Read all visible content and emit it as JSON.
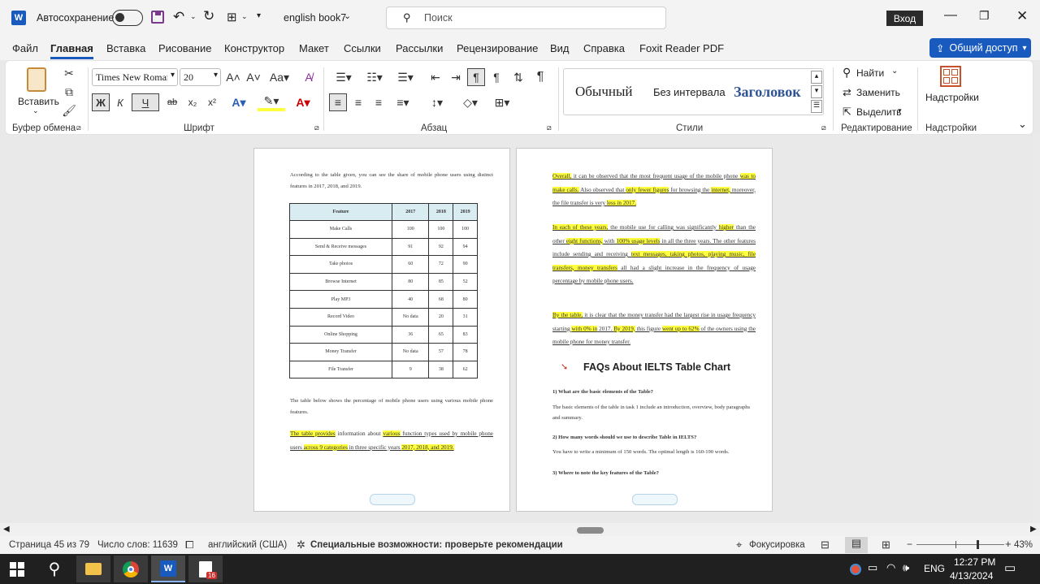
{
  "titlebar": {
    "autosave_label": "Автосохранение",
    "doc_name": "english book7",
    "search_placeholder": "Поиск",
    "signin_label": "Вход"
  },
  "menu": {
    "tabs": [
      "Файл",
      "Главная",
      "Вставка",
      "Рисование",
      "Конструктор",
      "Макет",
      "Ссылки",
      "Рассылки",
      "Рецензирование",
      "Вид",
      "Справка",
      "Foxit Reader PDF"
    ],
    "share_label": "Общий доступ"
  },
  "ribbon": {
    "paste_label": "Вставить",
    "clipboard_group": "Буфер обмена",
    "font_name": "Times New Roman",
    "font_size": "20",
    "font_group": "Шрифт",
    "paragraph_group": "Абзац",
    "styles": [
      "Обычный",
      "Без интервала",
      "Заголовок"
    ],
    "styles_group": "Стили",
    "find_label": "Найти",
    "replace_label": "Заменить",
    "select_label": "Выделить",
    "editing_group": "Редактирование",
    "addins_label": "Надстройки",
    "addins_group": "Надстройки",
    "bold": "Ж",
    "italic": "К",
    "underline": "Ч"
  },
  "page_left": {
    "intro": "According to the table given, you can see the share of mobile phone users using distinct features in 2017, 2018, and 2019.",
    "table_headers": [
      "Feature",
      "2017",
      "2018",
      "2019"
    ],
    "table_rows": [
      [
        "Make Calls",
        "100",
        "100",
        "100"
      ],
      [
        "Send & Receive messages",
        "91",
        "92",
        "94"
      ],
      [
        "Take photos",
        "60",
        "72",
        "90"
      ],
      [
        "Browse Internet",
        "80",
        "85",
        "52"
      ],
      [
        "Play MP3",
        "40",
        "68",
        "80"
      ],
      [
        "Record Video",
        "No data",
        "20",
        "31"
      ],
      [
        "Online Shopping",
        "36",
        "65",
        "83"
      ],
      [
        "Money Transfer",
        "No data",
        "57",
        "78"
      ],
      [
        "File Transfer",
        "9",
        "38",
        "62"
      ]
    ],
    "caption": "The table below shows the percentage of mobile phone users using various mobile phone features.",
    "summary_a": "The table provides",
    "summary_b": " information about ",
    "summary_c": "various",
    "summary_d": " function types used by mobile phone users ",
    "summary_e": "across 9 categories",
    "summary_f": " in three specific years ",
    "summary_g": "2017, 2018, and 2019."
  },
  "page_right": {
    "p1": [
      {
        "t": "Overall,",
        "hl": true
      },
      {
        "t": " it can be observed that the most frequent usage of the mobile phone ",
        "hl": false
      },
      {
        "t": "was to make calls.",
        "hl": true
      },
      {
        "t": " Also observed that ",
        "hl": false
      },
      {
        "t": "only fewer figures",
        "hl": true
      },
      {
        "t": " for browsing the ",
        "hl": false
      },
      {
        "t": "internet,",
        "hl": true
      },
      {
        "t": " moreover, the file transfer is very ",
        "hl": false
      },
      {
        "t": "less in 2017.",
        "hl": true
      }
    ],
    "p2": [
      {
        "t": "In each of these years,",
        "hl": true
      },
      {
        "t": " the mobile use for calling was significantly ",
        "hl": false
      },
      {
        "t": "higher",
        "hl": true
      },
      {
        "t": " than the other ",
        "hl": false
      },
      {
        "t": "eight functions,",
        "hl": true
      },
      {
        "t": " with ",
        "hl": false
      },
      {
        "t": "100% usage levels",
        "hl": true
      },
      {
        "t": " in all the three years.  The other features include sending and receiving ",
        "hl": false
      },
      {
        "t": "text messages, taking photos, playing music, file transfers, money transfers",
        "hl": true
      },
      {
        "t": " all had a slight increase in the frequency of usage percentage by mobile phone users.",
        "hl": false
      }
    ],
    "p3": [
      {
        "t": "By the table,",
        "hl": true
      },
      {
        "t": " it is clear that the money transfer had the largest rise in usage frequency starting ",
        "hl": false
      },
      {
        "t": "with 0% in",
        "hl": true
      },
      {
        "t": " 2017. ",
        "hl": false
      },
      {
        "t": "By 2019,",
        "hl": true
      },
      {
        "t": " this figure ",
        "hl": false
      },
      {
        "t": "went up to 62%",
        "hl": true
      },
      {
        "t": " of the owners using the mobile phone for money transfer.",
        "hl": false
      }
    ],
    "faq_heading": "FAQs About IELTS Table Chart",
    "q1": "1) What are the basic elements of the Table?",
    "a1": "The basic elements of the table in task 1 include an introduction, overview, body paragraphs and summary.",
    "q2": "2) How many words should we use to describe Table in IELTS?",
    "a2": "You have to write a minimum of 150 words. The optimal length is 160-190 words.",
    "q3": "3) Where to note the key features of the Table?"
  },
  "status": {
    "page": "Страница 45 из 79",
    "words": "Число слов: 11639",
    "language": "английский (США)",
    "accessibility": "Специальные возможности: проверьте рекомендации",
    "focus": "Фокусировка",
    "zoom": "43%"
  },
  "taskbar": {
    "time": "12:27 PM",
    "date": "4/13/2024",
    "lang": "ENG",
    "badge": "16"
  },
  "colors": {
    "accent": "#185abd",
    "highlight": "#ffff3c"
  }
}
